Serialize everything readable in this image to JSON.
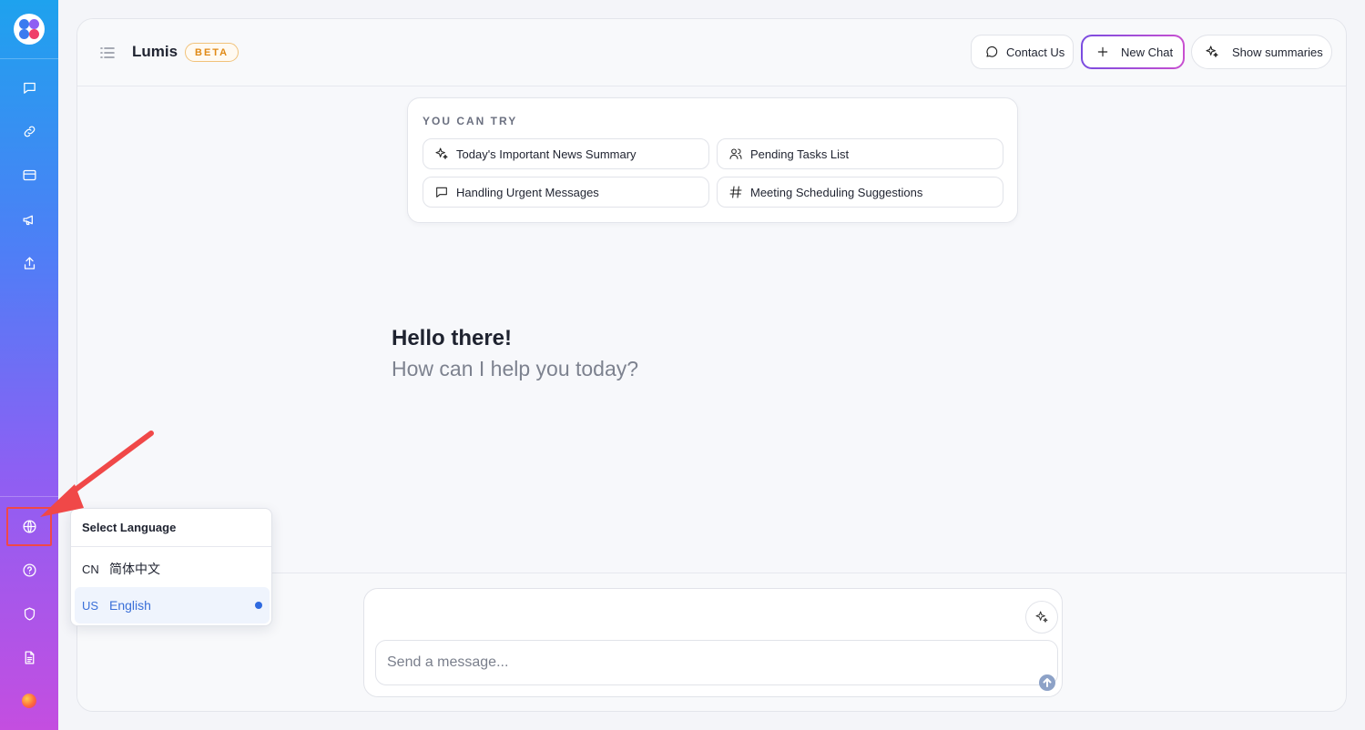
{
  "app": {
    "title": "Lumis",
    "badge": "BETA"
  },
  "header": {
    "contact_label": "Contact Us",
    "new_chat_label": "New Chat",
    "summaries_label": "Show summaries"
  },
  "suggestions": {
    "title": "YOU CAN TRY",
    "items": [
      {
        "label": "Today's Important News Summary",
        "icon": "sparkles-icon"
      },
      {
        "label": "Pending Tasks List",
        "icon": "users-icon"
      },
      {
        "label": "Handling Urgent Messages",
        "icon": "message-square-icon"
      },
      {
        "label": "Meeting Scheduling Suggestions",
        "icon": "hash-icon"
      }
    ]
  },
  "greeting": {
    "line1": "Hello there!",
    "line2": "How can I help you today?"
  },
  "composer": {
    "placeholder": "Send a message..."
  },
  "language_menu": {
    "title": "Select Language",
    "options": [
      {
        "code": "CN",
        "name": "简体中文",
        "selected": false
      },
      {
        "code": "US",
        "name": "English",
        "selected": true
      }
    ]
  },
  "sidebar": {
    "top_icons": [
      "chat-icon",
      "link-icon",
      "card-icon",
      "megaphone-icon",
      "upload-icon"
    ],
    "bottom_icons": [
      "globe-icon",
      "help-icon",
      "shield-icon",
      "document-icon"
    ]
  },
  "colors": {
    "accent": "#2f6ae0",
    "beta": "#e08a16",
    "annotation": "#f04848"
  }
}
